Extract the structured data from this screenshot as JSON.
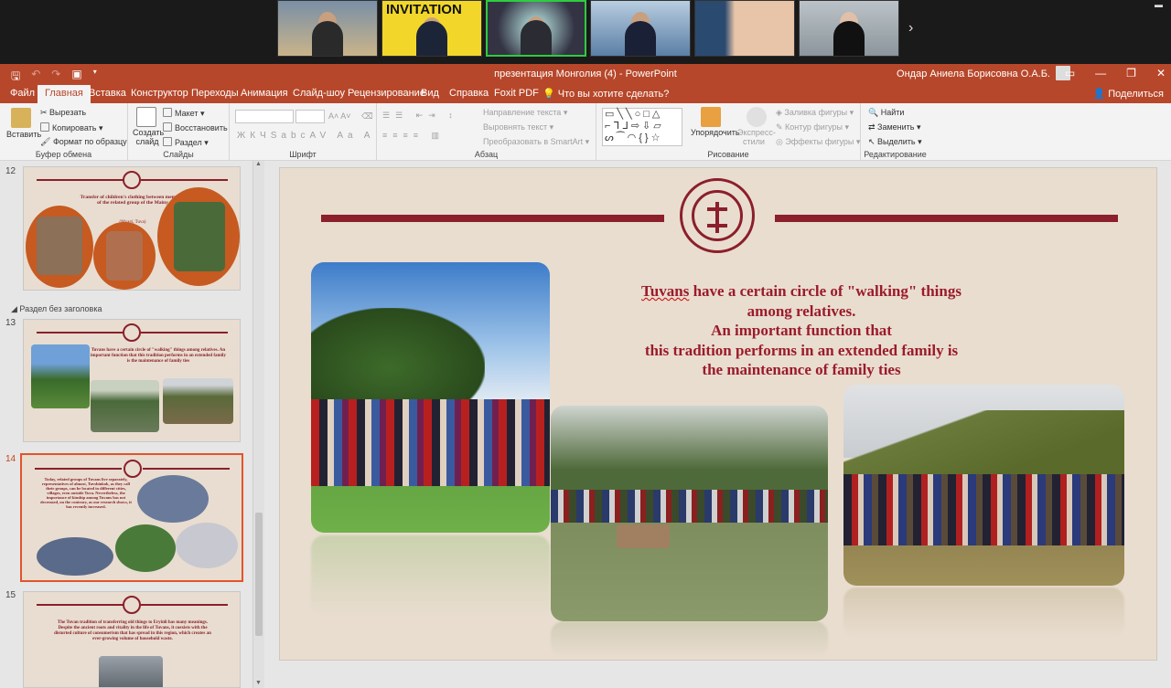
{
  "titlebar": {
    "title": "презентация Монголия (4)  -  PowerPoint",
    "user": "Ондар Аниела Борисовна О.А.Б.",
    "win_controls": [
      "▭",
      "—",
      "❐",
      "✕"
    ]
  },
  "tabs": [
    "Файл",
    "Главная",
    "Вставка",
    "Конструктор",
    "Переходы",
    "Анимация",
    "Слайд-шоу",
    "Рецензирование",
    "Вид",
    "Справка",
    "Foxit PDF"
  ],
  "tell_me": "Что вы хотите сделать?",
  "share": "Поделиться",
  "ribbon": {
    "clipboard": {
      "paste": "Вставить",
      "cut": "Вырезать",
      "copy": "Копировать",
      "format_painter": "Формат по образцу",
      "label": "Буфер обмена"
    },
    "slides": {
      "new_slide": "Создать слайд",
      "layout": "Макет",
      "reset": "Восстановить",
      "section": "Раздел",
      "label": "Слайды"
    },
    "font": {
      "label": "Шрифт"
    },
    "paragraph": {
      "text_direction": "Направление текста",
      "align_text": "Выровнять текст",
      "smartart": "Преобразовать в SmartArt",
      "label": "Абзац"
    },
    "drawing": {
      "arrange": "Упорядочить",
      "quick_styles": "Экспресс-стили",
      "fill": "Заливка фигуры",
      "outline": "Контур фигуры",
      "effects": "Эффекты фигуры",
      "label": "Рисование"
    },
    "editing": {
      "find": "Найти",
      "replace": "Заменить",
      "select": "Выделить",
      "label": "Редактирование"
    }
  },
  "thumbnails": {
    "section_label": "Раздел без заголовка",
    "items": [
      {
        "num": "12",
        "text": "Transfer of children's clothing between members of the related group of the Mainy",
        "caption": "(Myagi, Tuva)"
      },
      {
        "num": "13",
        "text": "Tuvans have a certain circle of \"walking\" things among relatives. An important function that this tradition performs in an extended family is the maintenance of family ties"
      },
      {
        "num": "14",
        "text": "Today, related groups of Tuvans live separately, representatives of almost, Tuvshinkok, as they call their groups, can be located in different cities, villages, even outside Tuva. Nevertheless, the importance of kinship among Tuvans has not decreased, on the contrary, as our research shows, it has recently increased."
      },
      {
        "num": "15",
        "text": "The Tuvan tradition of transferring old things to Eryinli has many meanings. Despite the ancient roots and vitality in the life of Tuvans, it coexists with the distorted culture of consumerism that has spread in this region, which creates an ever-growing volume of household waste."
      }
    ]
  },
  "slide": {
    "line1_pre": "",
    "line1_ul": "Tuvans",
    "line1_rest": " have a certain circle of \"walking\" things",
    "line2": "among relatives.",
    "line3": "An important function that",
    "line4": "this tradition performs in an extended family is",
    "line5": "the maintenance of family ties"
  },
  "video": {
    "next_icon": "›"
  },
  "colors": {
    "accent": "#b7472a",
    "slide_red": "#8b1f2b",
    "slide_bg": "#e9ddd0"
  }
}
